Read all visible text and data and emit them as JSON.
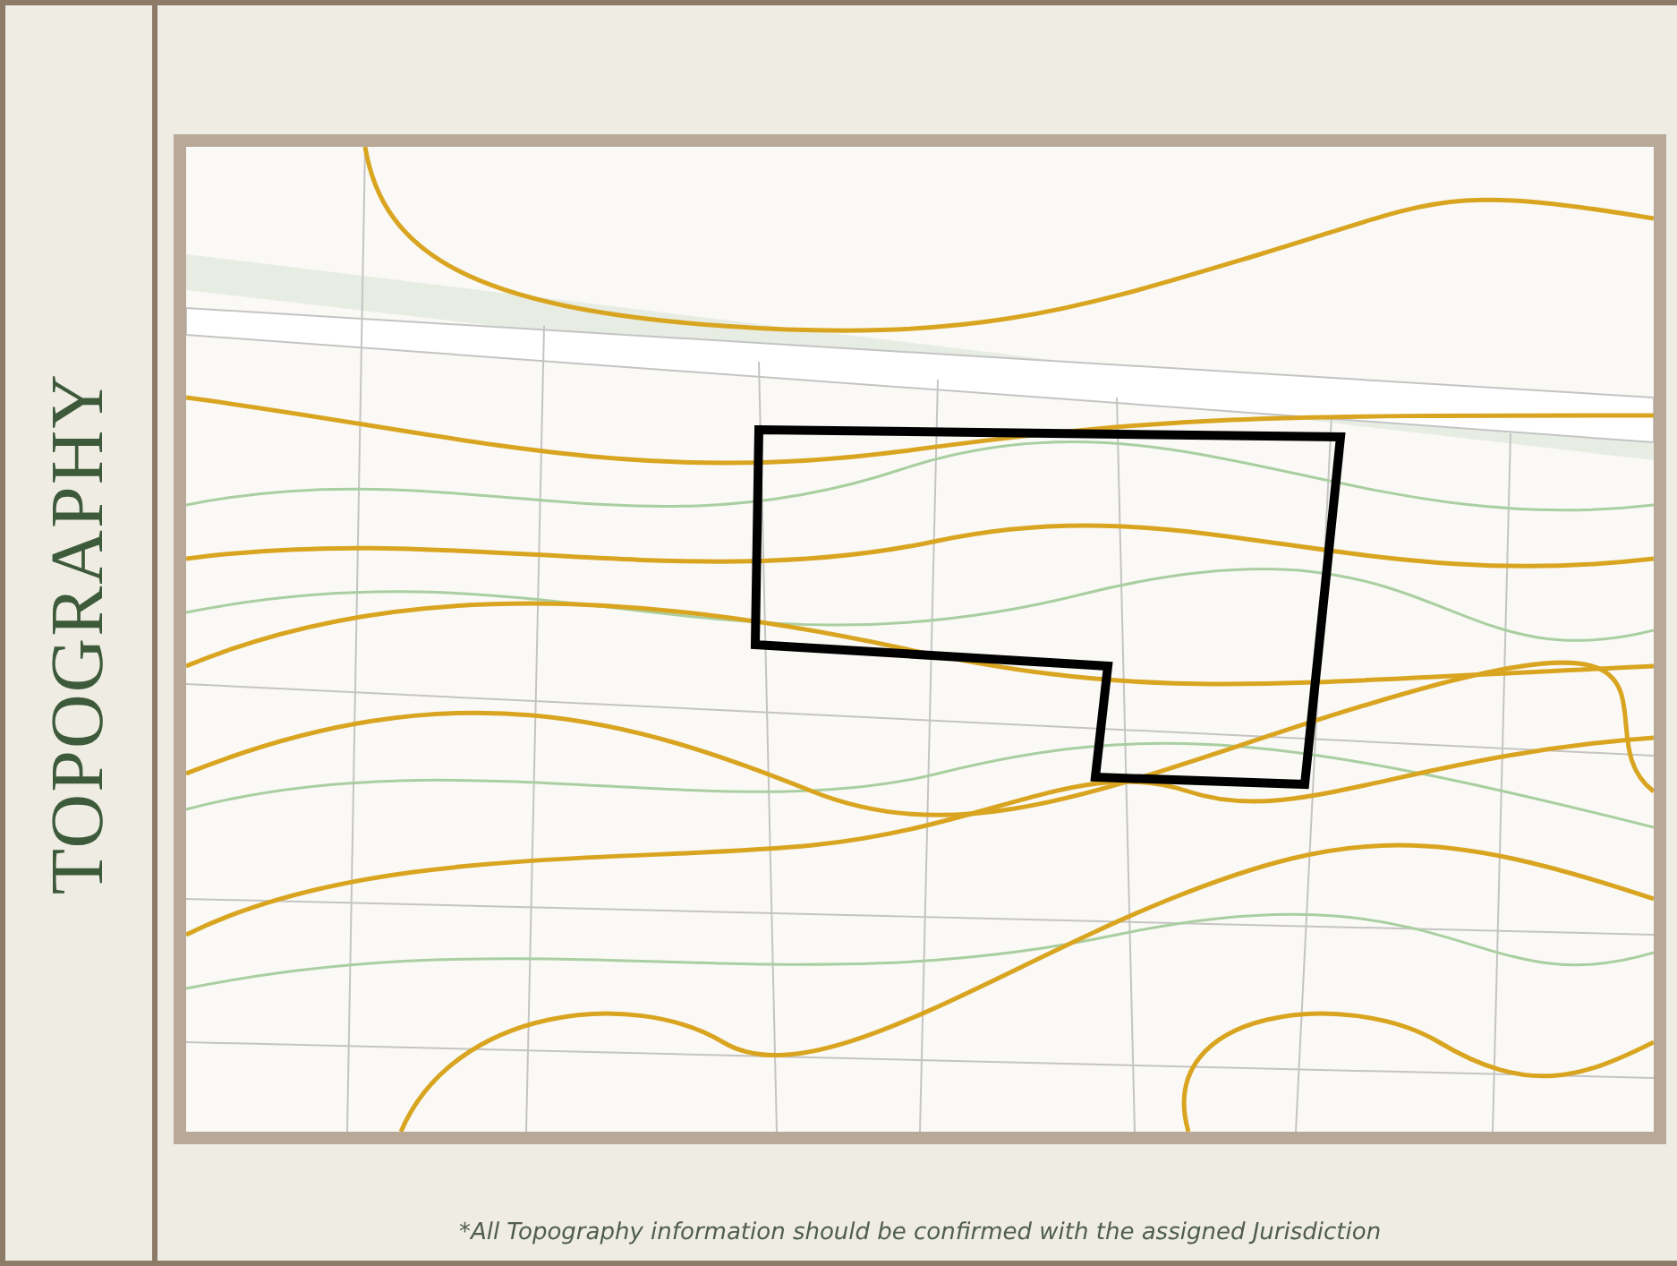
{
  "side_title": "TOPOGRAPHY",
  "map": {
    "kind": "topographic"
  },
  "footnote": "*All Topography information should be confirmed with the assigned Jurisdiction"
}
